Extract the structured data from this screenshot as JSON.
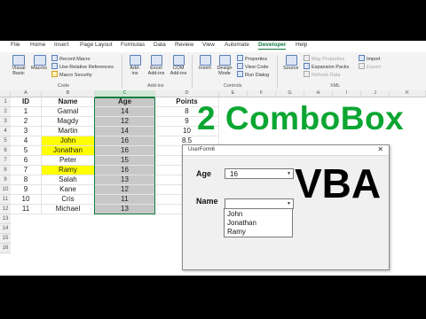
{
  "menu": {
    "tabs": [
      "File",
      "Home",
      "Insert",
      "Page Layout",
      "Formulas",
      "Data",
      "Review",
      "View",
      "Automate",
      "Developer",
      "Help"
    ],
    "active": "Developer"
  },
  "ribbon": {
    "code": {
      "visual_basic": "Visual Basic",
      "macros": "Macros",
      "record_macro": "Record Macro",
      "relative_refs": "Use Relative References",
      "macro_security": "Macro Security",
      "group": "Code"
    },
    "addins": {
      "addins": "Add-ins",
      "excel_addins": "Excel Add-ins",
      "com_addins": "COM Add-ins",
      "group": "Add-ins"
    },
    "controls": {
      "insert": "Insert",
      "design_mode": "Design Mode",
      "properties": "Properties",
      "view_code": "View Code",
      "run_dialog": "Run Dialog",
      "group": "Controls"
    },
    "xml": {
      "source": "Source",
      "map_properties": "Map Properties",
      "expansion_packs": "Expansion Packs",
      "refresh_data": "Refresh Data",
      "import": "Import",
      "export": "Export",
      "group": "XML"
    }
  },
  "sheet": {
    "columns": [
      "A",
      "B",
      "C",
      "D",
      "E",
      "F",
      "G",
      "H",
      "I",
      "J",
      "K"
    ],
    "rows": [
      "1",
      "2",
      "3",
      "4",
      "5",
      "6",
      "7",
      "8",
      "9",
      "10",
      "11",
      "12",
      "13",
      "14",
      "15",
      "16"
    ],
    "headers": {
      "id": "ID",
      "name": "Name",
      "age": "Age",
      "points": "Points"
    },
    "data": [
      {
        "id": "1",
        "name": "Gamal",
        "age": "14",
        "points": "8"
      },
      {
        "id": "2",
        "name": "Magdy",
        "age": "12",
        "points": "9"
      },
      {
        "id": "3",
        "name": "Martin",
        "age": "14",
        "points": "10"
      },
      {
        "id": "4",
        "name": "John",
        "age": "16",
        "points": "8.5"
      },
      {
        "id": "5",
        "name": "Jonathan",
        "age": "16",
        "points": ""
      },
      {
        "id": "6",
        "name": "Peter",
        "age": "15",
        "points": ""
      },
      {
        "id": "7",
        "name": "Ramy",
        "age": "16",
        "points": ""
      },
      {
        "id": "8",
        "name": "Salah",
        "age": "13",
        "points": ""
      },
      {
        "id": "9",
        "name": "Kane",
        "age": "12",
        "points": ""
      },
      {
        "id": "10",
        "name": "Cris",
        "age": "11",
        "points": ""
      },
      {
        "id": "11",
        "name": "Michael",
        "age": "13",
        "points": ""
      }
    ]
  },
  "userform": {
    "title": "UserForm6",
    "close": "✕",
    "age_label": "Age",
    "age_value": "16",
    "name_label": "Name",
    "name_value": "",
    "dropdown_arrow": "▼",
    "options": [
      "John",
      "Jonathan",
      "Ramy"
    ]
  },
  "overlay": {
    "title": "2 ComboBox",
    "subtitle": "VBA"
  },
  "colors": {
    "accent": "#107c41",
    "overlay_green": "#0ba632",
    "highlight": "#ffff00",
    "selected_column": "#c8c8c8"
  }
}
